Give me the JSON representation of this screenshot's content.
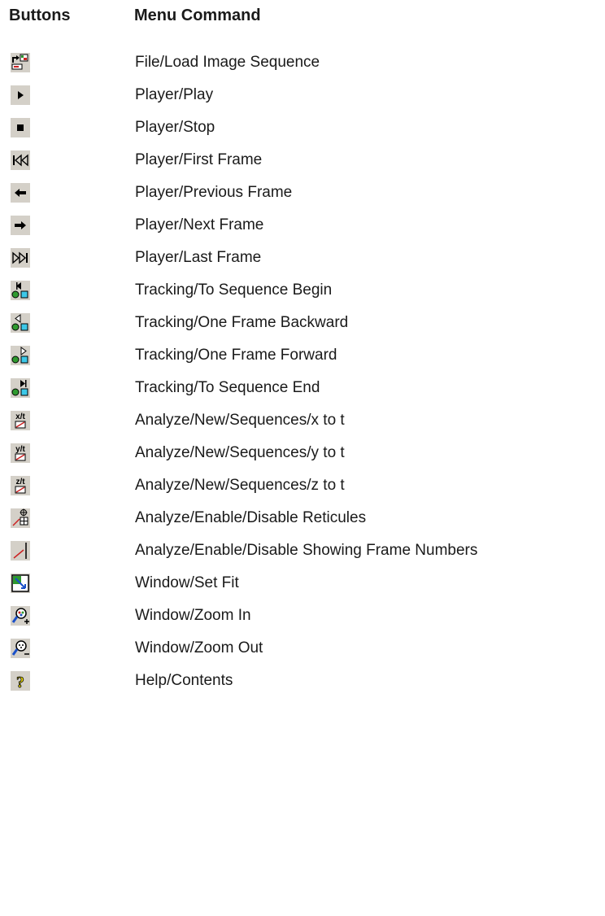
{
  "headers": {
    "buttons": "Buttons",
    "menu_command": "Menu Command"
  },
  "rows": [
    {
      "icon": "load-image-sequence-icon",
      "command": "File/Load Image Sequence"
    },
    {
      "icon": "play-icon",
      "command": "Player/Play"
    },
    {
      "icon": "stop-icon",
      "command": "Player/Stop"
    },
    {
      "icon": "first-frame-icon",
      "command": "Player/First Frame"
    },
    {
      "icon": "previous-frame-icon",
      "command": "Player/Previous Frame"
    },
    {
      "icon": "next-frame-icon",
      "command": "Player/Next Frame"
    },
    {
      "icon": "last-frame-icon",
      "command": "Player/Last Frame"
    },
    {
      "icon": "tracking-sequence-begin-icon",
      "command": "Tracking/To Sequence Begin"
    },
    {
      "icon": "tracking-frame-backward-icon",
      "command": "Tracking/One Frame Backward"
    },
    {
      "icon": "tracking-frame-forward-icon",
      "command": "Tracking/One Frame Forward"
    },
    {
      "icon": "tracking-sequence-end-icon",
      "command": "Tracking/To Sequence End"
    },
    {
      "icon": "x-to-t-icon",
      "command": "Analyze/New/Sequences/x to t"
    },
    {
      "icon": "y-to-t-icon",
      "command": "Analyze/New/Sequences/y to t"
    },
    {
      "icon": "z-to-t-icon",
      "command": "Analyze/New/Sequences/z to t"
    },
    {
      "icon": "reticules-icon",
      "command": "Analyze/Enable/Disable Reticules"
    },
    {
      "icon": "frame-numbers-icon",
      "command": "Analyze/Enable/Disable Showing Frame Numbers"
    },
    {
      "icon": "set-fit-icon",
      "command": "Window/Set Fit"
    },
    {
      "icon": "zoom-in-icon",
      "command": "Window/Zoom In"
    },
    {
      "icon": "zoom-out-icon",
      "command": "Window/Zoom Out"
    },
    {
      "icon": "help-icon",
      "command": "Help/Contents"
    }
  ],
  "icon_labels": {
    "x_to_t": "x/t",
    "y_to_t": "y/t",
    "z_to_t": "z/t",
    "help": "?"
  },
  "colors": {
    "button_face": "#d4d0c8",
    "tracking_green": "#2f9a2f",
    "tracking_cyan": "#3cc8e8",
    "graph_red": "#cc2222",
    "help_yellow": "#e8d800"
  }
}
